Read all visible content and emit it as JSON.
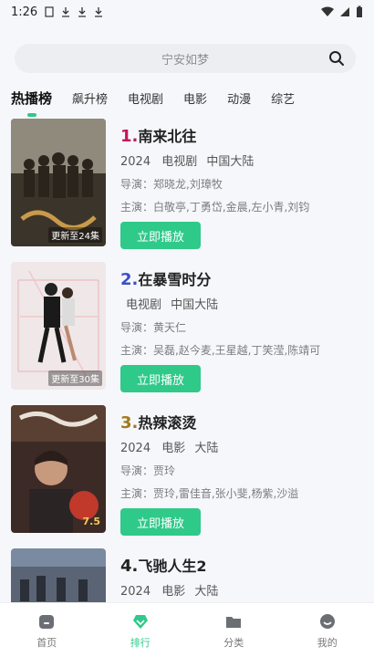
{
  "status_bar": {
    "time": "1:26"
  },
  "search": {
    "placeholder": "宁安如梦"
  },
  "tabs": [
    {
      "label": "热播榜",
      "active": true
    },
    {
      "label": "飙升榜",
      "active": false
    },
    {
      "label": "电视剧",
      "active": false
    },
    {
      "label": "电影",
      "active": false
    },
    {
      "label": "动漫",
      "active": false
    },
    {
      "label": "综艺",
      "active": false
    }
  ],
  "items": [
    {
      "rank": "1.",
      "rank_color": "#c2185b",
      "title": "南来北往",
      "year": "2024",
      "type": "电视剧",
      "region": "中国大陆",
      "director": "导演：郑晓龙,刘璋牧",
      "cast": "主演：白敬亭,丁勇岱,金晨,左小青,刘钧",
      "poster_tag": "更新至24集",
      "play_label": "立即播放"
    },
    {
      "rank": "2.",
      "rank_color": "#3a4fc8",
      "title": "在暴雪时分",
      "year": "",
      "type": "电视剧",
      "region": "中国大陆",
      "director": "导演：黄天仁",
      "cast": "主演：吴磊,赵今麦,王星越,丁笑滢,陈靖可",
      "poster_tag": "更新至30集",
      "play_label": "立即播放"
    },
    {
      "rank": "3.",
      "rank_color": "#a07a1c",
      "title": "热辣滚烫",
      "year": "2024",
      "type": "电影",
      "region": "大陆",
      "director": "导演：贾玲",
      "cast": "主演：贾玲,雷佳音,张小斐,杨紫,沙溢",
      "poster_score": "7.5",
      "play_label": "立即播放"
    },
    {
      "rank": "4.",
      "rank_color": "#222222",
      "title": "飞驰人生2",
      "year": "2024",
      "type": "电影",
      "region": "大陆"
    }
  ],
  "bottom_nav": [
    {
      "label": "首页",
      "icon": "home-icon",
      "active": false
    },
    {
      "label": "排行",
      "icon": "ranking-icon",
      "active": true
    },
    {
      "label": "分类",
      "icon": "folder-icon",
      "active": false
    },
    {
      "label": "我的",
      "icon": "profile-icon",
      "active": false
    }
  ],
  "colors": {
    "accent": "#2fc98a",
    "background": "#f6f7fb"
  }
}
